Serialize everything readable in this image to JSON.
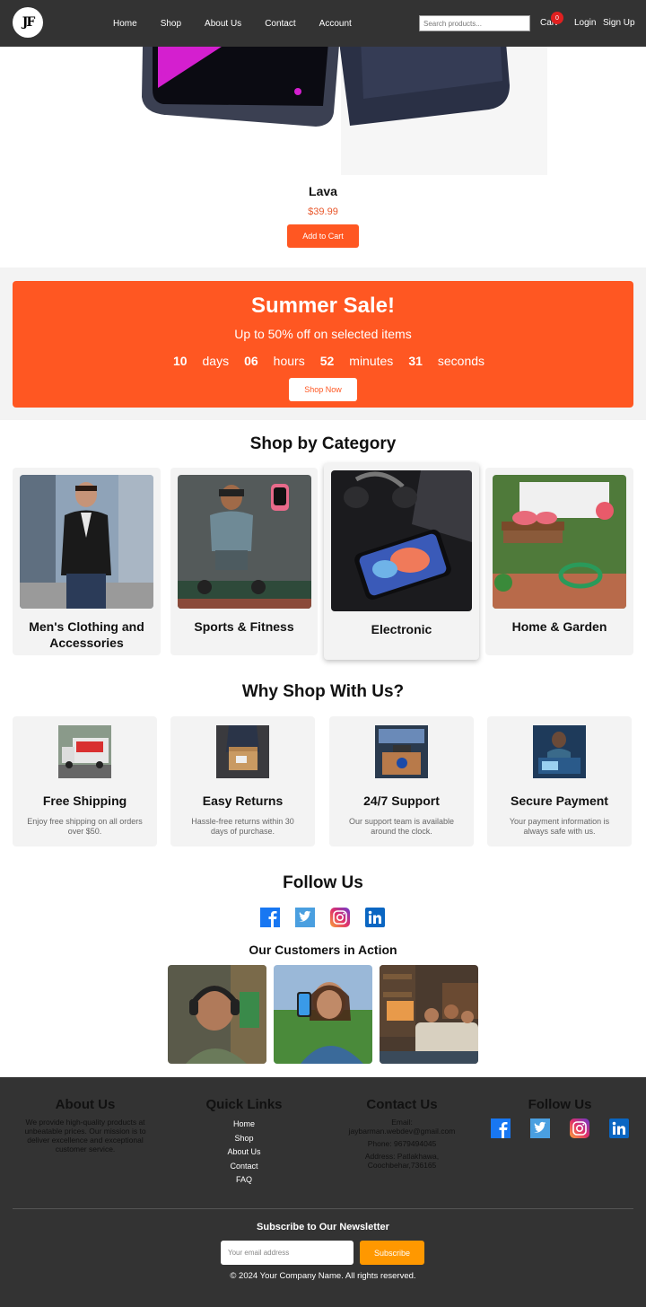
{
  "nav": {
    "logo_text": "JF",
    "links": [
      "Home",
      "Shop",
      "About Us",
      "Contact",
      "Account"
    ],
    "search_placeholder": "Search products...",
    "cart_label": "Cart",
    "cart_count": "0",
    "login": "Login",
    "signup": "Sign Up"
  },
  "product": {
    "name": "Lava",
    "price": "$39.99",
    "button": "Add to Cart"
  },
  "sale": {
    "title": "Summer Sale!",
    "subtitle": "Up to 50% off on selected items",
    "days": "10",
    "days_label": "days",
    "hours": "06",
    "hours_label": "hours",
    "minutes": "52",
    "minutes_label": "minutes",
    "seconds": "31",
    "seconds_label": "seconds",
    "button": "Shop Now"
  },
  "categories": {
    "title": "Shop by Category",
    "items": [
      {
        "label": "Men's Clothing and Accessories"
      },
      {
        "label": "Sports & Fitness"
      },
      {
        "label": "Electronic"
      },
      {
        "label": "Home & Garden"
      }
    ]
  },
  "why": {
    "title": "Why Shop With Us?",
    "items": [
      {
        "title": "Free Shipping",
        "desc": "Enjoy free shipping on all orders over $50."
      },
      {
        "title": "Easy Returns",
        "desc": "Hassle-free returns within 30 days of purchase."
      },
      {
        "title": "24/7 Support",
        "desc": "Our support team is available around the clock."
      },
      {
        "title": "Secure Payment",
        "desc": "Your payment information is always safe with us."
      }
    ]
  },
  "follow": {
    "title": "Follow Us",
    "customers_title": "Our Customers in Action"
  },
  "footer": {
    "about_title": "About Us",
    "about_text": "We provide high-quality products at unbeatable prices. Our mission is to deliver excellence and exceptional customer service.",
    "links_title": "Quick Links",
    "links": [
      "Home",
      "Shop",
      "About Us",
      "Contact",
      "FAQ"
    ],
    "contact_title": "Contact Us",
    "email": "Email: jaybarman.webdev@gmail.com",
    "phone": "Phone: 9679494045",
    "address": "Address: Patlakhawa, Coochbehar,736165",
    "follow_title": "Follow Us",
    "newsletter_title": "Subscribe to Our Newsletter",
    "newsletter_placeholder": "Your email address",
    "subscribe": "Subscribe",
    "copyright": "© 2024 Your Company Name. All rights reserved."
  },
  "colors": {
    "accent": "#ff5722",
    "dark": "#333333",
    "subscribe": "#ff9800",
    "price": "#e8562a"
  }
}
